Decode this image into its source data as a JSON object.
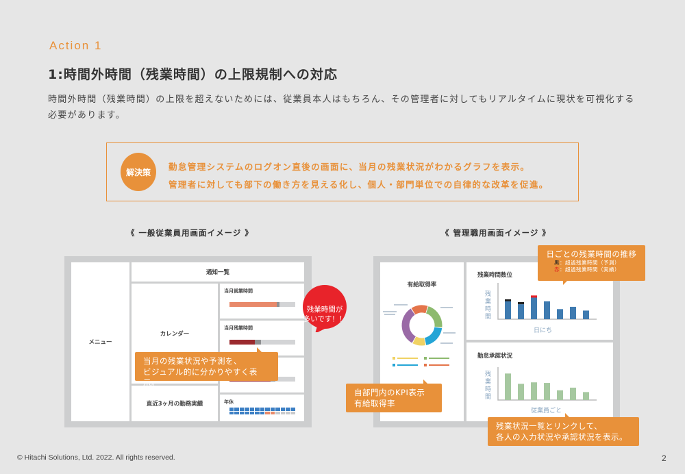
{
  "header": {
    "action_label": "Action 1",
    "title": "1:時間外時間（残業時間）の上限規制への対応",
    "description": "時間外時間（残業時間）の上限を超えないためには、従業員本人はもちろん、その管理者に対してもリアルタイムに現状を可視化する必要があります。"
  },
  "solution": {
    "badge": "解決策",
    "lines": [
      "勤怠管理システムのログオン直後の画面に、当月の残業状況がわかるグラフを表示。",
      "管理者に対しても部下の働き方を見える化し、個人・部門単位での自律的な改革を促進。"
    ]
  },
  "employee_screen": {
    "title": "《 一般従業員用画面イメージ 》",
    "menu": "メニュー",
    "notifications": "通知一覧",
    "calendar": "カレンダー",
    "recent": "直近3ヶ月の勤務実績",
    "widgets": [
      {
        "label": "当月就業時間",
        "fill_pct": 72,
        "forecast_pct": 4,
        "color": "#e8896a"
      },
      {
        "label": "当月残業時間",
        "fill_pct": 39,
        "forecast_pct": 9,
        "color": "#9b2a2e"
      },
      {
        "label": "",
        "fill_pct": 62,
        "forecast_pct": 8,
        "color": "#9b2a2e"
      },
      {
        "label": "年休",
        "used_days": 20,
        "planned_days": 2,
        "total_days": 26
      }
    ],
    "alert_bubble": [
      "残業時間が",
      "多いです！！"
    ],
    "callout": [
      "当月の残業状況や予測を、",
      "ビジュアル的に分かりやすく表示。"
    ]
  },
  "manager_screen": {
    "title": "《 管理職用画面イメージ 》",
    "leave_panel": {
      "title": "有給取得率",
      "donut": [
        {
          "color": "#e4744a",
          "share": 14
        },
        {
          "color": "#8dba6e",
          "share": 22
        },
        {
          "color": "#24a5d6",
          "share": 20
        },
        {
          "color": "#f0d264",
          "share": 11
        },
        {
          "color": "#9a6aa6",
          "share": 33
        }
      ],
      "legend_colors": [
        "#f0d264",
        "#8dba6e",
        "#24a5d6",
        "#e4744a"
      ]
    },
    "overtime_panel": {
      "title": "残業時間数位",
      "ylabel": "残業時間",
      "xlabel": "日にち",
      "bars": [
        {
          "actual": 62,
          "forecast_black": 14,
          "over_red": 0
        },
        {
          "actual": 52,
          "forecast_black": 15,
          "over_red": 0
        },
        {
          "actual": 75,
          "forecast_black": 0,
          "over_red": 15
        },
        {
          "actual": 62,
          "forecast_black": 0,
          "over_red": 0
        },
        {
          "actual": 35,
          "forecast_black": 0,
          "over_red": 0
        },
        {
          "actual": 43,
          "forecast_black": 0,
          "over_red": 0
        },
        {
          "actual": 30,
          "forecast_black": 0,
          "over_red": 0
        }
      ]
    },
    "approval_panel": {
      "title": "勤怠承認状況",
      "ylabel": "残業時間",
      "xlabel": "従業員ごと",
      "bars": [
        90,
        55,
        60,
        58,
        33,
        42,
        27
      ]
    },
    "trend_callout": {
      "title": "日ごとの残業時間の推移",
      "legend": [
        {
          "key": "黒",
          "key_color": "#222222",
          "text": "：超過残業時間（予測）"
        },
        {
          "key": "赤",
          "key_color": "#e02020",
          "text": "：超過残業時間（実績）"
        }
      ]
    },
    "kpi_callout": [
      "自部門内のKPI表示",
      "有給取得率"
    ],
    "approval_callout": [
      "残業状況一覧とリンクして、",
      "各人の入力状況や承認状況を表示。"
    ]
  },
  "footer": {
    "copyright": "© Hitachi Solutions, Ltd. 2022. All rights reserved.",
    "page_number": "2"
  }
}
